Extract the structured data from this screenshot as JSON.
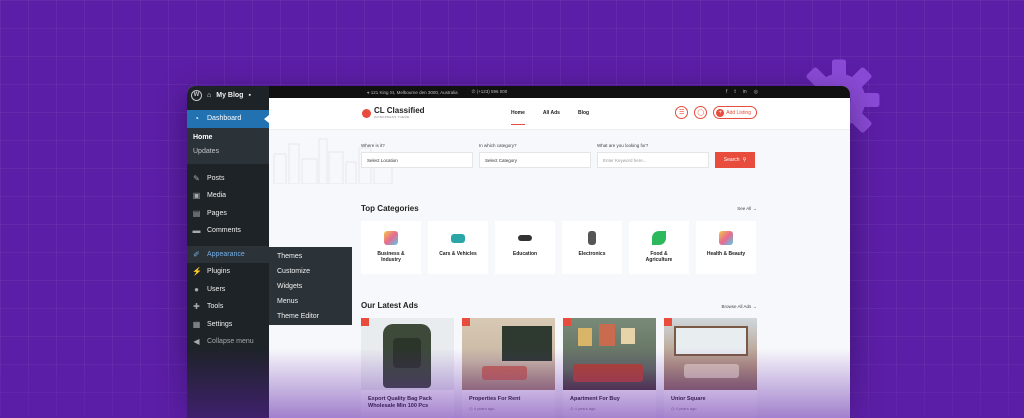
{
  "admin_bar": {
    "site_name": "My Blog"
  },
  "sidebar": {
    "dashboard": "Dashboard",
    "sub": [
      "Home",
      "Updates"
    ],
    "items": [
      {
        "label": "Posts",
        "icon": "pin-icon"
      },
      {
        "label": "Media",
        "icon": "media-icon"
      },
      {
        "label": "Pages",
        "icon": "pages-icon"
      },
      {
        "label": "Comments",
        "icon": "comment-icon"
      }
    ],
    "appearance": "Appearance",
    "items2": [
      {
        "label": "Plugins",
        "icon": "plugin-icon"
      },
      {
        "label": "Users",
        "icon": "user-icon"
      },
      {
        "label": "Tools",
        "icon": "wrench-icon"
      },
      {
        "label": "Settings",
        "icon": "settings-icon"
      }
    ],
    "collapse": "Collapse menu"
  },
  "flyout": [
    "Themes",
    "Customize",
    "Widgets",
    "Menus",
    "Theme Editor"
  ],
  "site": {
    "topbar": {
      "address": "121 King St, Melbourne den 3000, Australia",
      "phone": "(+123) 596 000"
    },
    "logo": {
      "title": "CL Classified",
      "subtitle": "WORDPRESS THEME"
    },
    "nav": [
      "Home",
      "All Ads",
      "Blog"
    ],
    "add_listing": "Add Listing",
    "search": {
      "where_label": "Where is it?",
      "where_value": "Select Location",
      "cat_label": "In which category?",
      "cat_value": "Select Category",
      "what_label": "What are you looking for?",
      "what_placeholder": "Enter Keyword here...",
      "button": "Search"
    },
    "top_categories": {
      "title": "Top Categories",
      "see_all": "See All →"
    },
    "categories": [
      {
        "line1": "Business &",
        "line2": "Industry",
        "color": "#e86a8e"
      },
      {
        "line1": "Cars & Vehicles",
        "line2": "",
        "color": "#2aa6a6"
      },
      {
        "line1": "Education",
        "line2": "",
        "color": "#333333"
      },
      {
        "line1": "Electronics",
        "line2": "",
        "color": "#555555"
      },
      {
        "line1": "Food &",
        "line2": "Agriculture",
        "color": "#2eb85c"
      },
      {
        "line1": "Health & Beauty",
        "line2": "",
        "color": "#e86a8e"
      }
    ],
    "latest_ads": {
      "title": "Our Latest Ads",
      "browse": "Browse All Ads →"
    },
    "ads": [
      {
        "title": "Export Quality Bag Pack Wholesale Min 100 Pcs",
        "meta": "",
        "bg": "#e9ecef"
      },
      {
        "title": "Properties For Rent",
        "meta": "4 years ago",
        "bg": "#c9b8a3"
      },
      {
        "title": "Apartment For Buy",
        "meta": "4 years ago",
        "bg": "#7a8a78"
      },
      {
        "title": "Unior Square",
        "meta": "4 years ago",
        "bg": "#b59a85"
      }
    ]
  }
}
